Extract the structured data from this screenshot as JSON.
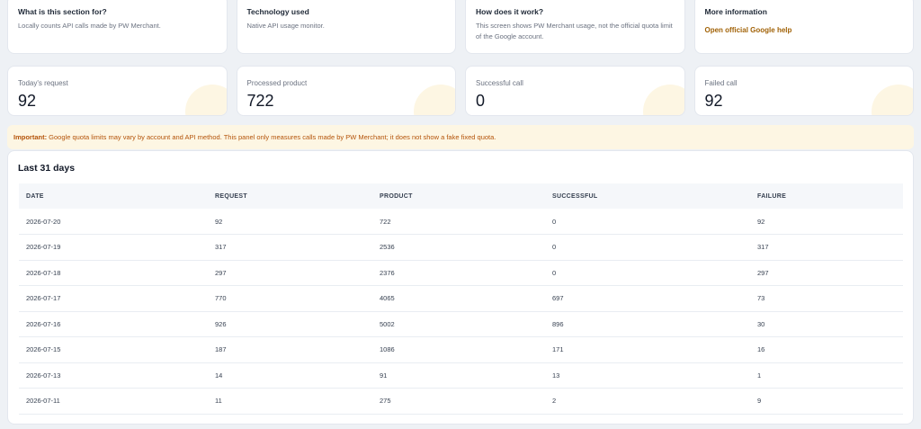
{
  "info_cards": [
    {
      "title": "What is this section for?",
      "desc": "Locally counts API calls made by PW Merchant."
    },
    {
      "title": "Technology used",
      "desc": "Native API usage monitor."
    },
    {
      "title": "How does it work?",
      "desc": "This screen shows PW Merchant usage, not the official quota limit of the Google account."
    },
    {
      "title": "More information",
      "link": "Open official Google help"
    }
  ],
  "stats": [
    {
      "label": "Today's request",
      "value": "92"
    },
    {
      "label": "Processed product",
      "value": "722"
    },
    {
      "label": "Successful call",
      "value": "0"
    },
    {
      "label": "Failed call",
      "value": "92"
    }
  ],
  "notice": {
    "strong": "Important:",
    "text": " Google quota limits may vary by account and API method. This panel only measures calls made by PW Merchant; it does not show a fake fixed quota."
  },
  "table": {
    "title": "Last 31 days",
    "headers": [
      "DATE",
      "REQUEST",
      "PRODUCT",
      "SUCCESSFUL",
      "FAILURE"
    ],
    "rows": [
      [
        "2026-07-20",
        "92",
        "722",
        "0",
        "92"
      ],
      [
        "2026-07-19",
        "317",
        "2536",
        "0",
        "317"
      ],
      [
        "2026-07-18",
        "297",
        "2376",
        "0",
        "297"
      ],
      [
        "2026-07-17",
        "770",
        "4065",
        "697",
        "73"
      ],
      [
        "2026-07-16",
        "926",
        "5002",
        "896",
        "30"
      ],
      [
        "2026-07-15",
        "187",
        "1086",
        "171",
        "16"
      ],
      [
        "2026-07-13",
        "14",
        "91",
        "13",
        "1"
      ],
      [
        "2026-07-11",
        "11",
        "275",
        "2",
        "9"
      ]
    ]
  },
  "colors": {
    "accent_link": "#a16207",
    "notice_bg": "#fdf6e3",
    "notice_text": "#b45309"
  }
}
